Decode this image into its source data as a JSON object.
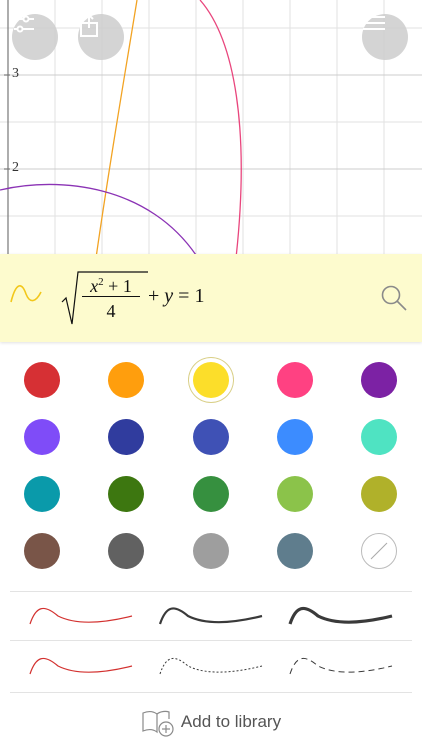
{
  "graph": {
    "y_tick_labels": [
      "3",
      "2"
    ],
    "curves": [
      {
        "color": "#e9467d",
        "shape": "circle-arc"
      },
      {
        "color": "#f2a323",
        "shape": "steep-line"
      },
      {
        "color": "#8b33b5",
        "shape": "circle-arc"
      }
    ],
    "buttons": {
      "settings_icon": "sliders-icon",
      "share_icon": "share-icon",
      "menu_icon": "hamburger-menu-icon"
    }
  },
  "expression": {
    "numerator_var": "x",
    "numerator_exp": "2",
    "numerator_rest": " + 1",
    "denominator": "4",
    "rest_plus": "+",
    "rest_var": "y",
    "rest_eq": " = 1",
    "curve_color": "#f2c71a"
  },
  "colors": [
    [
      "#d63034",
      "#ff9e0d",
      "#fcde2a",
      "#ff4182",
      "#7c22a4"
    ],
    [
      "#7f4cf8",
      "#303c9e",
      "#3f51b5",
      "#3c8cff",
      "#4fe3c2"
    ],
    [
      "#0a9aaa",
      "#3d7710",
      "#36903f",
      "#8bc34a",
      "#b0b12a"
    ],
    [
      "#795548",
      "#616161",
      "#9e9e9e",
      "#5f7d8d",
      "none"
    ]
  ],
  "selected_color": "#fcde2a",
  "line_style_color": "#d3312f",
  "footer": {
    "add_library_label": "Add to library",
    "add_library_icon": "book-add-icon"
  }
}
